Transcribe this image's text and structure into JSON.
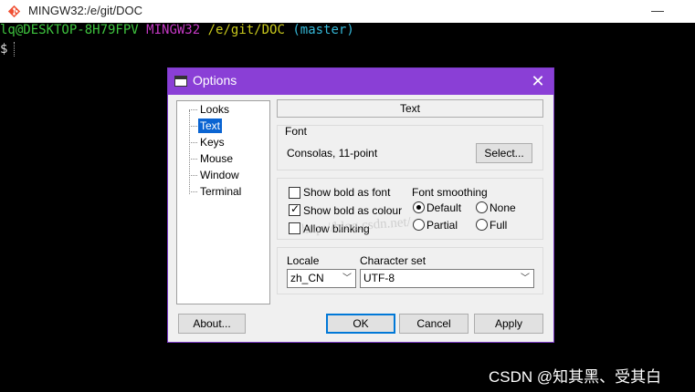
{
  "window": {
    "title": "MINGW32:/e/git/DOC",
    "minimize": "—"
  },
  "terminal": {
    "user": "lq@DESKTOP-8H79FPV",
    "system": "MINGW32",
    "path": "/e/git/DOC",
    "branch": "(master)",
    "prompt_symbol": "$"
  },
  "dialog": {
    "title": "Options",
    "close": "✕",
    "tree": [
      "Looks",
      "Text",
      "Keys",
      "Mouse",
      "Window",
      "Terminal"
    ],
    "selected_item": "Text",
    "section_header": "Text",
    "font": {
      "group_label": "Font",
      "value": "Consolas, 11-point",
      "select_button": "Select..."
    },
    "options": {
      "show_bold_as_font": {
        "label": "Show bold as font",
        "checked": false
      },
      "show_bold_as_colour": {
        "label": "Show bold as colour",
        "checked": true
      },
      "allow_blinking": {
        "label": "Allow blinking",
        "checked": false
      }
    },
    "font_smoothing": {
      "label": "Font smoothing",
      "choices": [
        "Default",
        "None",
        "Partial",
        "Full"
      ],
      "selected": "Default"
    },
    "locale": {
      "label": "Locale",
      "value": "zh_CN"
    },
    "charset": {
      "label": "Character set",
      "value": "UTF-8"
    },
    "buttons": {
      "about": "About...",
      "ok": "OK",
      "cancel": "Cancel",
      "apply": "Apply"
    }
  },
  "overlay": {
    "watermark": "http://blog.csdn.net/",
    "credit": "CSDN @知其黑、受其白"
  },
  "colors": {
    "dialog_title_bg": "#8a3fd6",
    "selection_bg": "#0a64d2",
    "prompt_user": "#3ec33e",
    "prompt_system": "#c238c2",
    "prompt_path": "#c9c91c",
    "prompt_branch": "#35b8d8"
  },
  "icons": [
    "git-diamond-icon",
    "console-window-icon",
    "checkmark-icon",
    "chevron-down-icon"
  ]
}
